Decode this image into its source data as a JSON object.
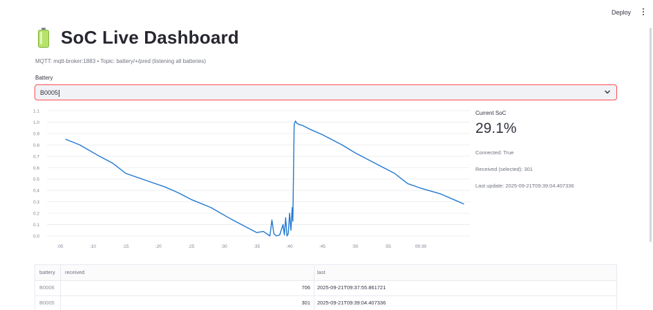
{
  "header": {
    "deploy_label": "Deploy",
    "menu_icon": "kebab-menu-icon"
  },
  "page": {
    "icon": "battery-icon",
    "title": "SoC Live Dashboard",
    "subtitle": "MQTT: mqtt-broker:1883 • Topic: battery/+/pred (listening all batteries)"
  },
  "battery_select": {
    "label": "Battery",
    "value": "B0005",
    "icon": "chevron-down-icon",
    "accent": "#ff4b4b"
  },
  "metrics": {
    "current_soc_label": "Current SoC",
    "current_soc_value": "29.1%",
    "connected": "Connected: True",
    "received": "Received (selected): 301",
    "last_update": "Last update: 2025-09-21T09:39:04.407336"
  },
  "chart_data": {
    "type": "line",
    "line_color": "#1f77d0",
    "grid": true,
    "ylim": [
      0.0,
      1.1
    ],
    "yticks": [
      "0.0",
      "0.1",
      "0.2",
      "0.3",
      "0.4",
      "0.5",
      "0.6",
      "0.7",
      "0.8",
      "0.9",
      "1.0",
      "1.1"
    ],
    "xticks": [
      ":05",
      ":10",
      ":15",
      ":20",
      ":25",
      ":30",
      ":35",
      ":40",
      ":45",
      ":50",
      ":55",
      "09:39"
    ],
    "x": [
      2.8,
      5,
      8,
      10,
      12,
      15,
      18,
      20,
      22,
      25,
      28,
      30,
      32,
      33,
      34,
      34.3,
      34.6,
      35,
      35.5,
      36,
      36.2,
      36.4,
      36.6,
      36.8,
      37,
      37.2,
      37.4,
      37.5,
      37.7,
      37.9,
      38.1,
      38.4,
      39,
      40,
      42,
      45,
      47,
      50,
      53,
      55,
      57,
      60,
      62,
      63.6
    ],
    "values": [
      0.85,
      0.8,
      0.7,
      0.64,
      0.55,
      0.49,
      0.43,
      0.38,
      0.32,
      0.25,
      0.15,
      0.09,
      0.03,
      0.04,
      0.0,
      0.14,
      0.02,
      0.0,
      0.01,
      0.1,
      0.01,
      0.16,
      0.0,
      0.02,
      0.2,
      0.05,
      0.25,
      0.13,
      0.98,
      1.01,
      0.99,
      0.98,
      0.97,
      0.94,
      0.89,
      0.8,
      0.73,
      0.64,
      0.55,
      0.46,
      0.42,
      0.37,
      0.32,
      0.28
    ]
  },
  "table": {
    "columns": [
      "battery",
      "received",
      "last"
    ],
    "rows": [
      {
        "battery": "B0006",
        "received": "706",
        "last": "2025-09-21T09:37:55.861721"
      },
      {
        "battery": "B0005",
        "received": "301",
        "last": "2025-09-21T09:39:04.407336"
      }
    ]
  }
}
